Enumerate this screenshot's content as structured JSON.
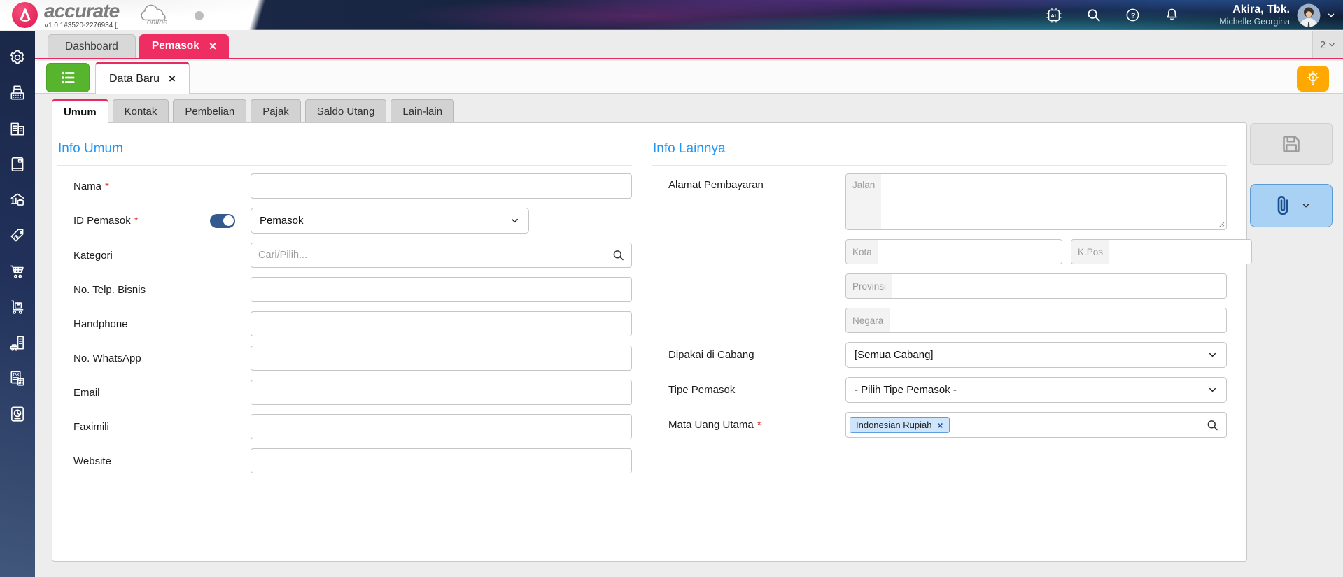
{
  "app": {
    "brand": "accurate",
    "brand_suffix": "online",
    "version": "v1.0.1#3520-2276934 []",
    "company": "Akira, Tbk.",
    "user": "Michelle Georgina",
    "open_tabs_count": "2"
  },
  "window_tabs": {
    "dashboard": "Dashboard",
    "pemasok": "Pemasok"
  },
  "document_tab": {
    "label": "Data Baru"
  },
  "form_tabs": [
    "Umum",
    "Kontak",
    "Pembelian",
    "Pajak",
    "Saldo Utang",
    "Lain-lain"
  ],
  "glyphs": {
    "close": "×",
    "required": "*"
  },
  "info_umum": {
    "title": "Info Umum",
    "fields": {
      "nama": "Nama",
      "id_pemasok": "ID Pemasok",
      "id_pemasok_value": "Pemasok",
      "kategori": "Kategori",
      "kategori_placeholder": "Cari/Pilih...",
      "telp": "No. Telp. Bisnis",
      "handphone": "Handphone",
      "whatsapp": "No. WhatsApp",
      "email": "Email",
      "faximili": "Faximili",
      "website": "Website"
    }
  },
  "info_lainnya": {
    "title": "Info Lainnya",
    "fields": {
      "alamat": "Alamat Pembayaran",
      "jalan": "Jalan",
      "kota": "Kota",
      "kpos": "K.Pos",
      "provinsi": "Provinsi",
      "negara": "Negara",
      "cabang": "Dipakai di Cabang",
      "cabang_value": "[Semua Cabang]",
      "tipe": "Tipe Pemasok",
      "tipe_value": "- Pilih Tipe Pemasok -",
      "mata_uang": "Mata Uang Utama",
      "mata_uang_value": "Indonesian Rupiah"
    }
  },
  "sidebar": {
    "items": [
      "settings",
      "cash-register",
      "company",
      "journal",
      "bank",
      "sales",
      "purchases",
      "inventory",
      "fixed-assets",
      "tax",
      "reports"
    ]
  },
  "colors": {
    "accent_pink": "#ee2e63",
    "accent_green": "#56b42d",
    "accent_orange": "#ffa800",
    "heading_blue": "#2196f3",
    "sidebar_navy": "#1d2c55",
    "attachment_blue": "#a9d1f4"
  }
}
